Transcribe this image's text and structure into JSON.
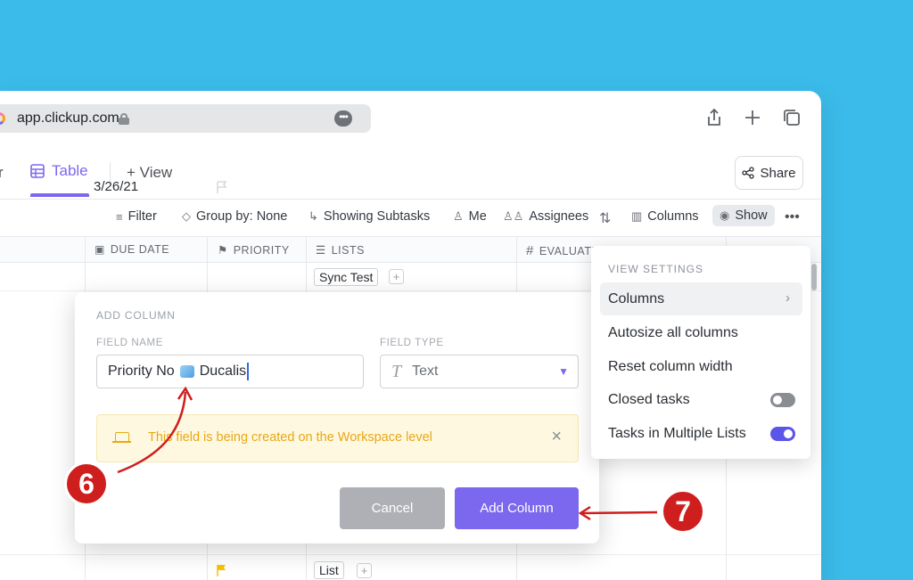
{
  "browser": {
    "url": "app.clickup.com"
  },
  "tabs": {
    "partial": "r",
    "table": "Table",
    "add_view": "View",
    "share": "Share"
  },
  "toolbar": {
    "filter": "Filter",
    "group_by": "Group by: None",
    "subtasks": "Showing Subtasks",
    "me": "Me",
    "assignees": "Assignees",
    "columns": "Columns",
    "show": "Show"
  },
  "columns": {
    "due_date": "DUE DATE",
    "priority": "PRIORITY",
    "lists": "LISTS",
    "evaluation": "EVALUATI"
  },
  "rows": [
    {
      "due_date": "3/26/21",
      "list": "Sync Test",
      "flag_color": "#cfd2d6"
    },
    {
      "due_date": "",
      "list": "List",
      "flag_color": "#f5c400"
    }
  ],
  "add_column_dialog": {
    "title": "ADD COLUMN",
    "field_name_label": "FIELD NAME",
    "field_name_prefix": "Priority No",
    "field_name_suffix": "Ducalis",
    "field_type_label": "FIELD TYPE",
    "field_type_value": "Text",
    "warning": "This field is being created on the Workspace level",
    "cancel": "Cancel",
    "add": "Add Column"
  },
  "view_settings": {
    "title": "VIEW SETTINGS",
    "items": [
      {
        "label": "Columns"
      },
      {
        "label": "Autosize all columns"
      },
      {
        "label": "Reset column width"
      },
      {
        "label": "Closed tasks",
        "toggle": false
      },
      {
        "label": "Tasks in Multiple Lists",
        "toggle": true
      }
    ]
  },
  "annotations": {
    "step6": "6",
    "step7": "7"
  },
  "colors": {
    "accent": "#7b68ee",
    "background": "#3bbbe9",
    "badge": "#cf1e1e",
    "warning": "#e6a817"
  }
}
